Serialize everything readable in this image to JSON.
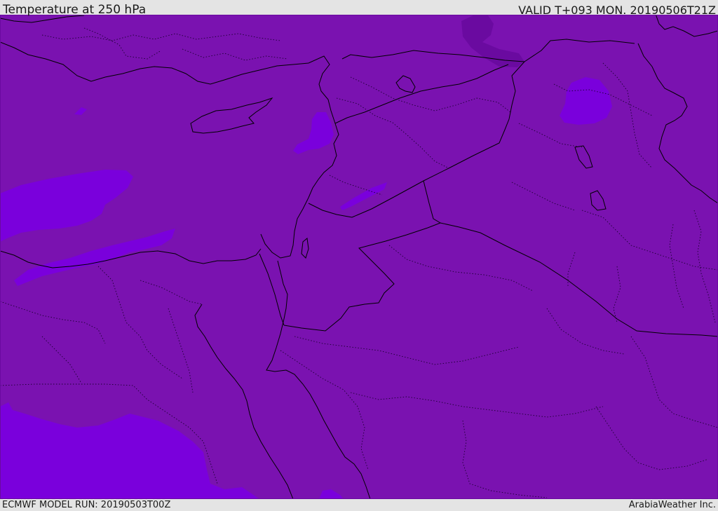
{
  "header": {
    "title": "Temperature at 250 hPa",
    "valid": "VALID T+093 MON. 20190506T21Z"
  },
  "footer": {
    "model_run": "ECMWF MODEL RUN: 20190503T00Z",
    "credit": "ArabiaWeather Inc."
  },
  "map": {
    "region": "Eastern Mediterranean and Middle East",
    "field": "temperature",
    "pressure_level": "250 hPa",
    "colors": {
      "base_fill": "#7a12b0",
      "colder_fill": "#7a00dc",
      "coldest_fill": "#8a2cf0",
      "warmer_fill": "#6a0aa0",
      "coastline": "#000000",
      "borders": "#000000"
    }
  }
}
